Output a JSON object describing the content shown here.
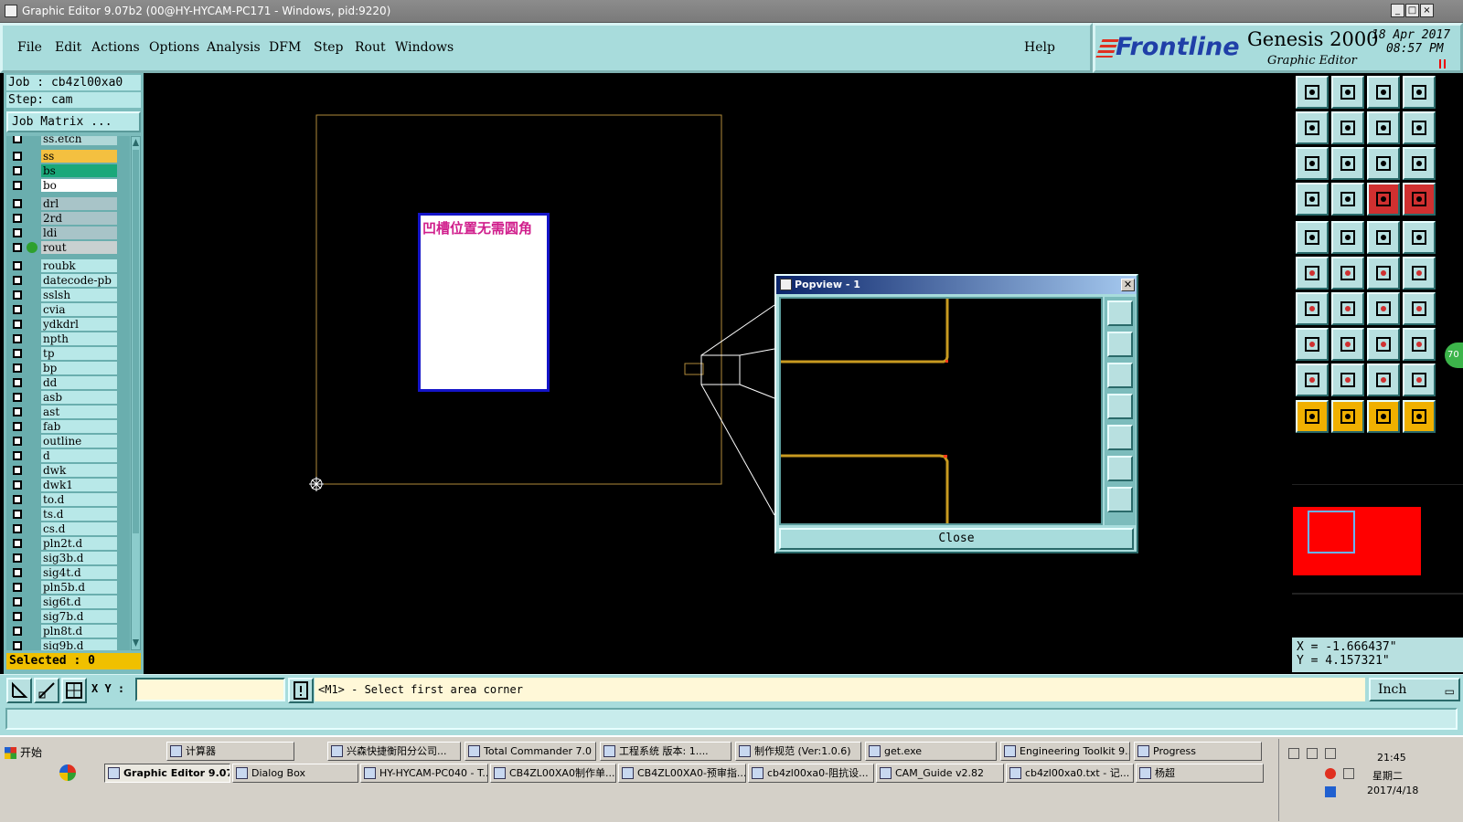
{
  "window": {
    "title": "Graphic Editor 9.07b2 (00@HY-HYCAM-PC171 - Windows, pid:9220)"
  },
  "menu": {
    "items": [
      "File",
      "Edit",
      "Actions",
      "Options",
      "Analysis",
      "DFM",
      "Step",
      "Rout",
      "Windows"
    ],
    "help": "Help"
  },
  "brand": {
    "logo": "Frontline",
    "product": "Genesis 2000",
    "subtitle": "Graphic Editor",
    "date": "18 Apr 2017",
    "time": "08:57 PM"
  },
  "job": {
    "job": "Job  : cb4zl00xa0",
    "step": "Step: cam",
    "matrix_label": "Job Matrix ...",
    "selected": "Selected : 0"
  },
  "layers": [
    {
      "name": "ss.etch",
      "color": "#b0d8d8"
    },
    {
      "name": "ss",
      "color": "#f4c040"
    },
    {
      "name": "bs",
      "color": "#1aa87a"
    },
    {
      "name": "bo",
      "color": "#ffffff"
    },
    {
      "name": "drl",
      "color": "#a8c4c8"
    },
    {
      "name": "2rd",
      "color": "#a8c4c8"
    },
    {
      "name": "ldi",
      "color": "#a8c4c8"
    },
    {
      "name": "rout",
      "color": "#c8d0d0",
      "active": true
    },
    {
      "name": "roubk",
      "color": "#b8e8e8"
    },
    {
      "name": "datecode-pb",
      "color": "#b8e8e8"
    },
    {
      "name": "sslsh",
      "color": "#b8e8e8"
    },
    {
      "name": "cvia",
      "color": "#b8e8e8"
    },
    {
      "name": "ydkdrl",
      "color": "#b8e8e8"
    },
    {
      "name": "npth",
      "color": "#b8e8e8"
    },
    {
      "name": "tp",
      "color": "#b8e8e8"
    },
    {
      "name": "bp",
      "color": "#b8e8e8"
    },
    {
      "name": "dd",
      "color": "#b8e8e8"
    },
    {
      "name": "asb",
      "color": "#b8e8e8"
    },
    {
      "name": "ast",
      "color": "#b8e8e8"
    },
    {
      "name": "fab",
      "color": "#b8e8e8"
    },
    {
      "name": "outline",
      "color": "#b8e8e8"
    },
    {
      "name": "d",
      "color": "#b8e8e8"
    },
    {
      "name": "dwk",
      "color": "#b8e8e8"
    },
    {
      "name": "dwk1",
      "color": "#b8e8e8"
    },
    {
      "name": "to.d",
      "color": "#b8e8e8"
    },
    {
      "name": "ts.d",
      "color": "#b8e8e8"
    },
    {
      "name": "cs.d",
      "color": "#b8e8e8"
    },
    {
      "name": "pln2t.d",
      "color": "#b8e8e8"
    },
    {
      "name": "sig3b.d",
      "color": "#b8e8e8"
    },
    {
      "name": "sig4t.d",
      "color": "#b8e8e8"
    },
    {
      "name": "pln5b.d",
      "color": "#b8e8e8"
    },
    {
      "name": "sig6t.d",
      "color": "#b8e8e8"
    },
    {
      "name": "sig7b.d",
      "color": "#b8e8e8"
    },
    {
      "name": "pln8t.d",
      "color": "#b8e8e8"
    },
    {
      "name": "sig9b.d",
      "color": "#b8e8e8"
    }
  ],
  "canvas": {
    "note": "凹槽位置无需圆角"
  },
  "popview": {
    "title": "Popview - 1",
    "close": "Close"
  },
  "coords": {
    "x": "X = -1.666437\"",
    "y": "Y =  4.157321\""
  },
  "badge": "70",
  "bottom": {
    "xy_label": "X Y :",
    "xy_value": "",
    "prompt": "<M1> - Select first area corner",
    "unit": "Inch"
  },
  "taskbar": {
    "start": "开始",
    "row1": [
      "计算器",
      "兴森快捷衡阳分公司...",
      "Total Commander 7.0 ...",
      "工程系统  版本: 1....",
      "制作规范 (Ver:1.0.6)",
      "get.exe",
      "Engineering Toolkit 9....",
      "Progress"
    ],
    "row2": [
      "Graphic Editor 9.07...",
      "Dialog Box",
      "HY-HYCAM-PC040 - T...",
      "CB4ZL00XA0制作单....",
      "CB4ZL00XA0-预审指...",
      "cb4zl00xa0-阻抗设...",
      "CAM_Guide v2.82",
      "cb4zl00xa0.txt - 记...",
      "杨超"
    ],
    "clock": "21:45",
    "weekday": "星期二",
    "date": "2017/4/18"
  },
  "colors": {
    "board_outline": "#b08a3a",
    "trace": "#c89a20",
    "menu_bg": "#a8dcdc",
    "red_block": "#ff0000"
  }
}
